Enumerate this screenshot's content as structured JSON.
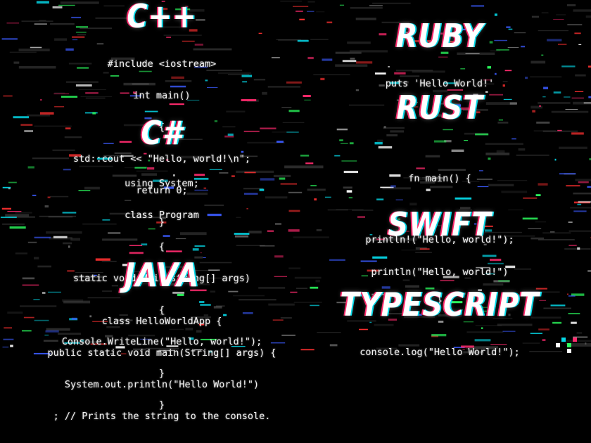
{
  "colors": {
    "background": "#000000",
    "text": "#ffffff",
    "glitch_pink": "#ff2a6d",
    "glitch_cyan": "#05d9e8",
    "glitch_green": "#2bff5e",
    "glitch_red": "#ff3030"
  },
  "sections": {
    "cpp": {
      "title": "C++",
      "lines": [
        "#include <iostream>",
        "int main()",
        "{",
        "std::cout << \"Hello, world!\\n\";",
        "return 0;",
        "}"
      ]
    },
    "csharp": {
      "title": "C#",
      "lines": [
        "using System;",
        "class Program",
        "{",
        "static void Main(string[] args)",
        "{",
        "Console.WriteLine(\"Hello, world!\");",
        "}",
        "}"
      ]
    },
    "java": {
      "title": "JAVA",
      "lines": [
        "class HelloWorldApp {",
        "public static void main(String[] args) {",
        "System.out.println(\"Hello World!\")",
        "; // Prints the string to the console."
      ]
    },
    "ruby": {
      "title": "RUBY",
      "lines": [
        "puts 'Hello World!'"
      ]
    },
    "rust": {
      "title": "RUST",
      "lines": [
        "fn main() {",
        "println!(\"Hello, world!\");",
        "}"
      ]
    },
    "swift": {
      "title": "SWIFT",
      "lines": [
        "println(\"Hello, world!\")"
      ]
    },
    "typescript": {
      "title": "TYPESCRIPT",
      "lines": [
        "console.log(\"Hello World!\");"
      ]
    }
  }
}
